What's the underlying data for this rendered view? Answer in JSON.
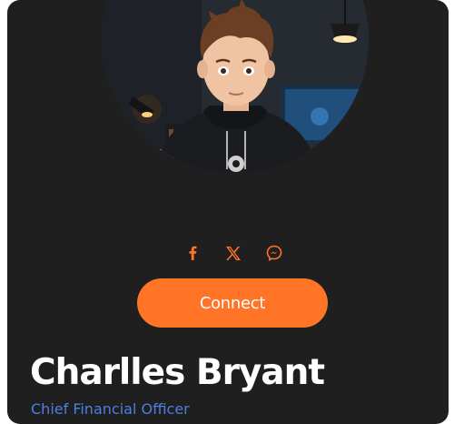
{
  "profile": {
    "name": "Charlles Bryant",
    "role": "Chief Financial Officer",
    "avatar_alt": "avatar"
  },
  "social": [
    {
      "icon": "facebook-icon"
    },
    {
      "icon": "x-icon"
    },
    {
      "icon": "messenger-icon"
    }
  ],
  "actions": {
    "connect_label": "Connect"
  },
  "colors": {
    "card_background": "#1f1f1f",
    "accent": "#ff7427",
    "role_text": "#4d7fe0",
    "name_text": "#ffffff"
  }
}
